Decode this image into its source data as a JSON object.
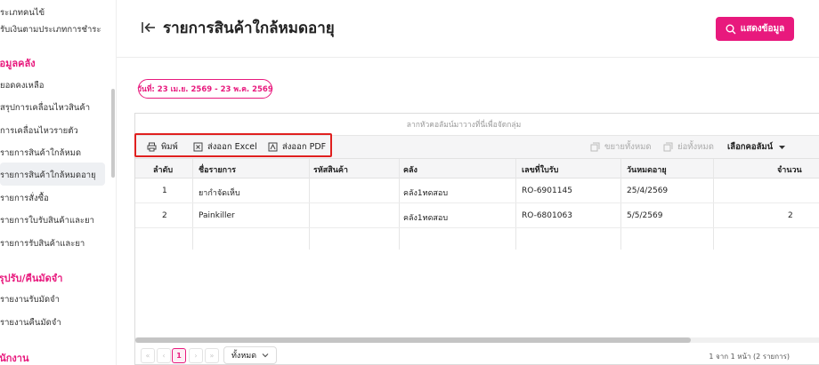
{
  "sidebar": {
    "items_top": [
      "ประเภทคนไข้",
      "ปรับเงินตามประเภทการชำระ"
    ],
    "section_inventory": "ข้อมูลคลัง",
    "inventory_items": [
      "ยอดคงเหลือ",
      "สรุปการเคลื่อนไหวสินค้า",
      "การเคลื่อนไหวรายตัว",
      "รายการสินค้าใกล้หมด",
      "รายการสินค้าใกล้หมดอายุ",
      "รายการสั่งซื้อ",
      "รายการใบรับสินค้าและยา",
      "รายการรับสินค้าและยา"
    ],
    "section_deposit": "สรุปรับ/คืนมัดจำ",
    "deposit_items": [
      "รายงานรับมัดจำ",
      "รายงานคืนมัดจำ"
    ],
    "section_staff": "พนักงาน"
  },
  "header": {
    "title": "รายการสินค้าใกล้หมดอายุ",
    "show_button": "แสดงข้อมูล"
  },
  "filter": {
    "date_range": "วันที่: 23 เม.ย. 2569 - 23 พ.ค. 2569"
  },
  "grid": {
    "group_panel_text": "ลากหัวคอลัมน์มาวางที่นี่เพื่อจัดกลุ่ม",
    "toolbar": {
      "print": "พิมพ์",
      "export_excel": "ส่งออก Excel",
      "export_pdf": "ส่งออก PDF",
      "expand_all": "ขยายทั้งหมด",
      "collapse_all": "ย่อทั้งหมด",
      "choose_columns": "เลือกคอลัมน์"
    },
    "columns": [
      "ลำดับ",
      "ชื่อรายการ",
      "รหัสสินค้า",
      "คลัง",
      "เลขที่ใบรับ",
      "วันหมดอายุ",
      "จำนวน"
    ],
    "rows": [
      {
        "no": "1",
        "name": "ยากำจัดเห็บ",
        "code": "",
        "warehouse": "คลัง1ทดสอบ",
        "receipt": "RO-6901145",
        "expiry": "25/4/2569",
        "qty": ""
      },
      {
        "no": "2",
        "name": "Painkiller",
        "code": "",
        "warehouse": "คลัง1ทดสอบ",
        "receipt": "RO-6801063",
        "expiry": "5/5/2569",
        "qty": "2"
      }
    ]
  },
  "pager": {
    "current_page": "1",
    "page_size": "ทั้งหมด",
    "info": "1 จาก 1 หน้า (2 รายการ)"
  },
  "colors": {
    "accent": "#e8197d",
    "highlight_box": "#e0201f"
  }
}
